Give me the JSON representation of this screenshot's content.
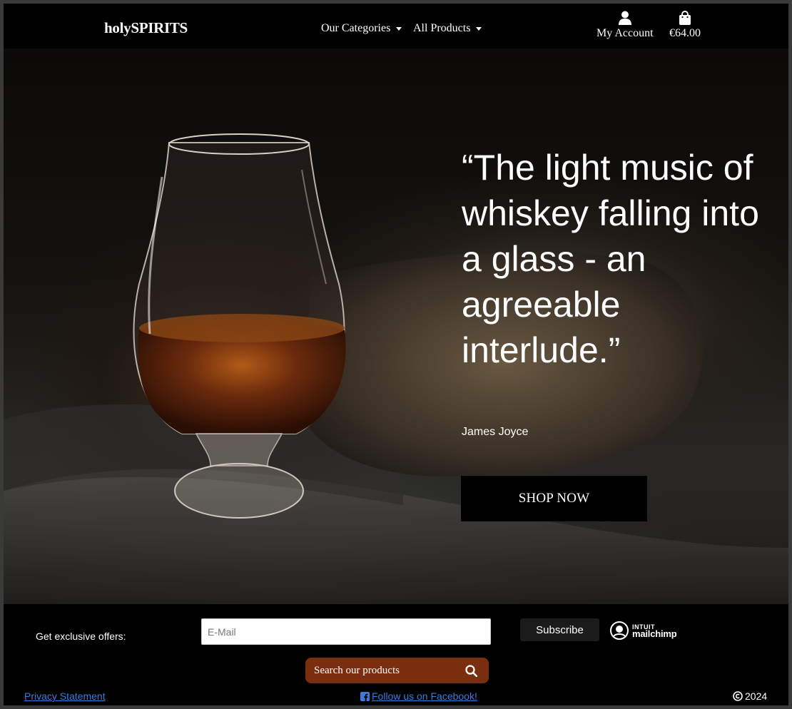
{
  "navbar": {
    "brand": "holySPIRITS",
    "categories_label": "Our Categories",
    "products_label": "All Products",
    "account_label": "My Account",
    "cart_total": "€64.00"
  },
  "hero": {
    "quote": "“The light music of whiskey falling into a glass - an agreeable interlude.”",
    "author": "James Joyce",
    "cta_label": "SHOP NOW"
  },
  "footer": {
    "offers_label": "Get exclusive offers:",
    "email_placeholder": "E-Mail",
    "subscribe_label": "Subscribe",
    "mailchimp_intuit": "INTUIT",
    "mailchimp_brand": "mailchimp",
    "search_label": "Search our products",
    "privacy_label": "Privacy Statement",
    "facebook_label": "Follow us on Facebook!",
    "copyright_year": "2024"
  },
  "colors": {
    "background": "#000000",
    "search_button": "#7a2e10",
    "link": "#3d7bd9",
    "text": "#ffffff"
  }
}
